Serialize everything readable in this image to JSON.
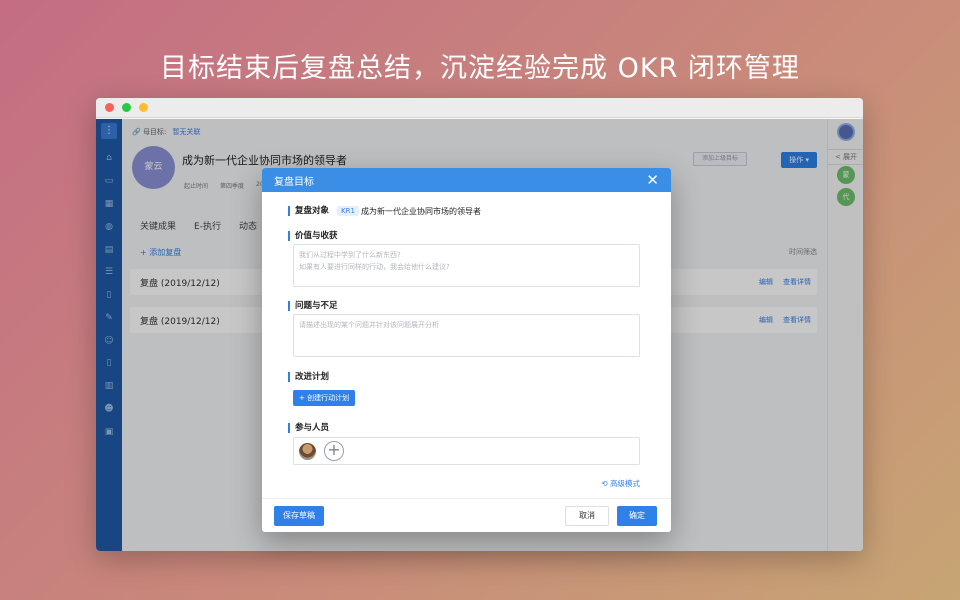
{
  "headline": "目标结束后复盘总结，沉淀经验完成 OKR 闭环管理",
  "app": {
    "parent_goal_label": "母目标:",
    "parent_goal_link": "暂无关联",
    "owner_avatar_text": "蒙云",
    "goal_title": "成为新一代企业协同市场的领导者",
    "meta": {
      "deadline_label": "起止时间",
      "quarter": "第四季度",
      "year_prefix": "20"
    },
    "pin_button": "添加上级目标",
    "operate_button": "操作 ▾",
    "tabs": [
      "关键成果",
      "E-执行",
      "动态"
    ],
    "add_review": "+ 添加复盘",
    "time_filter": "时间筛选",
    "reviews": [
      {
        "title": "复盘 (2019/12/12)",
        "edit": "编辑",
        "detail": "查看详情"
      },
      {
        "title": "复盘 (2019/12/12)",
        "edit": "编辑",
        "detail": "查看详情"
      }
    ],
    "right_rail": {
      "expand": "< 展开",
      "avatar_1": "蒙",
      "avatar_2": "代"
    }
  },
  "modal": {
    "title": "复盘目标",
    "close_icon": "close-icon",
    "review_target_label": "复盘对象",
    "kr_tag": "KR1",
    "kr_name": "成为新一代企业协同市场的领导者",
    "value_label": "价值与收获",
    "value_placeholder": "我们从过程中学到了什么新东西?\n如果有人要进行同样的行动，我会给他什么建议?",
    "issues_label": "问题与不足",
    "issues_placeholder": "请描述出现的某个问题并针对该问题展开分析",
    "plan_label": "改进计划",
    "create_plan_button": "+ 创建行动计划",
    "participants_label": "参与人员",
    "add_person_icon": "plus-icon",
    "advanced_mode": "高级模式",
    "save_draft": "保存草稿",
    "cancel": "取消",
    "confirm": "确定"
  },
  "colors": {
    "primary": "#2f80e8",
    "nav": "#1e5aa8",
    "modal_header": "#3a8ee6"
  }
}
